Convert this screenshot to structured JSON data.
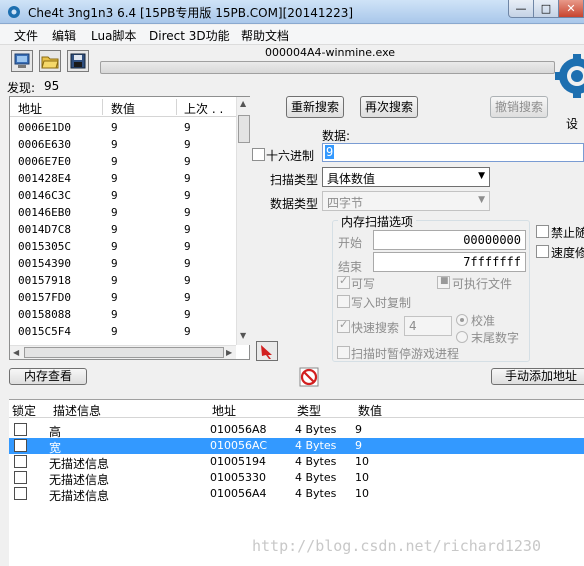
{
  "window": {
    "title": "Che4t 3ng1n3 6.4 [15PB专用版 15PB.COM][20141223]",
    "min_label": "—",
    "max_label": "□",
    "close_label": "✕"
  },
  "menu": [
    "文件",
    "编辑",
    "Lua脚本",
    "Direct 3D功能",
    "帮助文档"
  ],
  "process": {
    "name": "000004A4-winmine.exe"
  },
  "found": {
    "label": "发现:",
    "count": "95"
  },
  "results": {
    "headers": {
      "address": "地址",
      "value": "数值",
      "previous": "上次 . ."
    },
    "rows": [
      {
        "address": "0006E1D0",
        "value": "9",
        "previous": "9"
      },
      {
        "address": "0006E630",
        "value": "9",
        "previous": "9"
      },
      {
        "address": "0006E7E0",
        "value": "9",
        "previous": "9"
      },
      {
        "address": "001428E4",
        "value": "9",
        "previous": "9"
      },
      {
        "address": "00146C3C",
        "value": "9",
        "previous": "9"
      },
      {
        "address": "00146EB0",
        "value": "9",
        "previous": "9"
      },
      {
        "address": "0014D7C8",
        "value": "9",
        "previous": "9"
      },
      {
        "address": "0015305C",
        "value": "9",
        "previous": "9"
      },
      {
        "address": "00154390",
        "value": "9",
        "previous": "9"
      },
      {
        "address": "00157918",
        "value": "9",
        "previous": "9"
      },
      {
        "address": "00157FD0",
        "value": "9",
        "previous": "9"
      },
      {
        "address": "00158088",
        "value": "9",
        "previous": "9"
      },
      {
        "address": "0015C5F4",
        "value": "9",
        "previous": "9"
      }
    ]
  },
  "scan": {
    "new_scan": "重新搜索",
    "next_scan": "再次搜索",
    "undo_scan": "撤销搜索",
    "value_label": "数据:",
    "value": "9",
    "hex_label": "十六进制",
    "scan_type_label": "扫描类型",
    "scan_type": "具体数值",
    "value_type_label": "数据类型",
    "value_type": "四字节",
    "settings_label": "设"
  },
  "memory_options": {
    "title": "内存扫描选项",
    "start_label": "开始",
    "start_value": "00000000",
    "stop_label": "结束",
    "stop_value": "7fffffff",
    "writable": "可写",
    "executable": "可执行文件",
    "copy_on_write": "写入时复制",
    "fast_scan": "快速搜索",
    "fast_scan_value": "4",
    "alignment": "校准",
    "last_digits": "末尾数字",
    "pause_game": "扫描时暂停游戏进程",
    "disable_random": "禁止随",
    "speed_hack": "速度修"
  },
  "bottom": {
    "memory_view": "内存查看",
    "add_manual": "手动添加地址"
  },
  "address_list": {
    "headers": {
      "active": "锁定",
      "description": "描述信息",
      "address": "地址",
      "type": "类型",
      "value": "数值"
    },
    "rows": [
      {
        "description": "高",
        "address": "010056A8",
        "type": "4 Bytes",
        "value": "9",
        "selected": false
      },
      {
        "description": "宽",
        "address": "010056AC",
        "type": "4 Bytes",
        "value": "9",
        "selected": true
      },
      {
        "description": "无描述信息",
        "address": "01005194",
        "type": "4 Bytes",
        "value": "10",
        "selected": false
      },
      {
        "description": "无描述信息",
        "address": "01005330",
        "type": "4 Bytes",
        "value": "10",
        "selected": false
      },
      {
        "description": "无描述信息",
        "address": "010056A4",
        "type": "4 Bytes",
        "value": "10",
        "selected": false
      }
    ]
  },
  "watermark": "http://blog.csdn.net/richard1230",
  "colors": {
    "selection": "#3399ff",
    "logo": "#1d6fb0",
    "stop": "#d22020"
  }
}
